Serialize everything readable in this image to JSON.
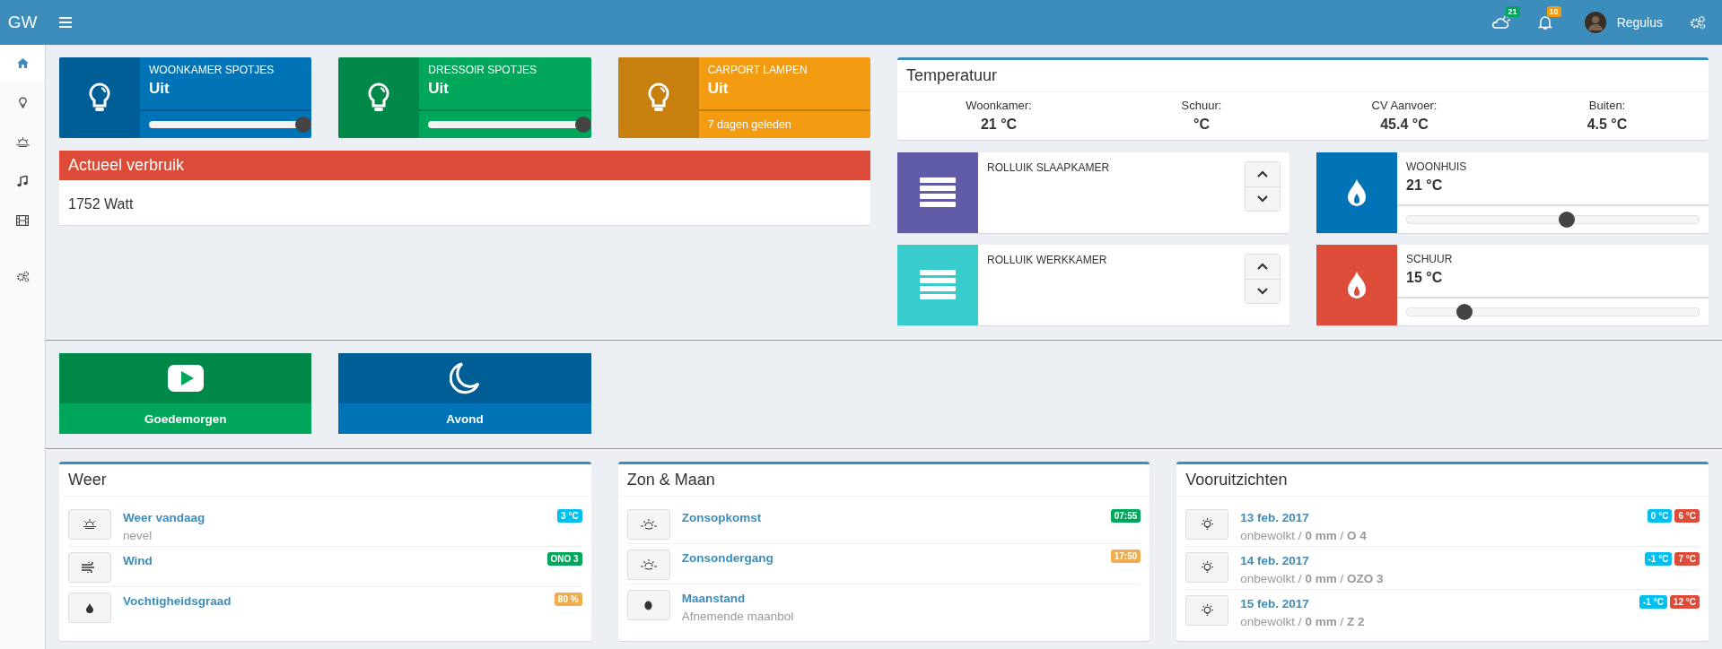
{
  "topbar": {
    "brand": "GW",
    "notifications": [
      {
        "kind": "weather",
        "count": "21",
        "color": "#00a65a"
      },
      {
        "kind": "bell",
        "count": "10",
        "color": "#f39c12"
      }
    ],
    "user": "Regulus"
  },
  "sidebar": {
    "items": [
      {
        "kind": "home",
        "selected": true
      },
      {
        "kind": "bulb",
        "selected": false
      },
      {
        "kind": "sunrise",
        "selected": false
      },
      {
        "kind": "music",
        "selected": false
      },
      {
        "kind": "film",
        "selected": false
      },
      {
        "kind": "gears",
        "selected": false
      }
    ]
  },
  "switches": [
    {
      "kind": "dimmer",
      "name": "WOONKAMER SPOTJES",
      "status": "Uit",
      "level": 1,
      "color": "#0073b7"
    },
    {
      "kind": "dimmer",
      "name": "DRESSOIR SPOTJES",
      "status": "Uit",
      "level": 1,
      "color": "#00a65a"
    },
    {
      "kind": "switch",
      "name": "CARPORT LAMPEN",
      "status": "Uit",
      "last_seen": "7 dagen geleden",
      "color": "#f39c12"
    }
  ],
  "usage": {
    "title": "Actueel verbruik",
    "value": "1752 Watt"
  },
  "temperature": {
    "title": "Temperatuur",
    "sensors": [
      {
        "label": "Woonkamer:",
        "value": "21 °C"
      },
      {
        "label": "Schuur:",
        "value": "°C"
      },
      {
        "label": "CV Aanvoer:",
        "value": "45.4 °C"
      },
      {
        "label": "Buiten:",
        "value": "4.5 °C"
      }
    ]
  },
  "blinds": [
    {
      "name": "ROLLUIK SLAAPKAMER",
      "color": "#605ca8"
    },
    {
      "name": "ROLLUIK WERKKAMER",
      "color": "#39cccc"
    }
  ],
  "thermostats": [
    {
      "name": "WOONHUIS",
      "value": "21 °C",
      "level": 0.55,
      "color": "#0073b7"
    },
    {
      "name": "SCHUUR",
      "value": "15 °C",
      "level": 0.18,
      "color": "#dd4b39"
    }
  ],
  "scenes": [
    {
      "kind": "play",
      "name": "Goedemorgen",
      "color": "#00a65a"
    },
    {
      "kind": "moon",
      "name": "Avond",
      "color": "#0073b7"
    }
  ],
  "widgets": [
    {
      "title": "Weer",
      "items": [
        {
          "kind": "fog",
          "title": "Weer vandaag",
          "subtitle": "nevel",
          "badges": [
            {
              "text": "3 °C",
              "color": "#00c0ef"
            }
          ]
        },
        {
          "kind": "wind",
          "title": "Wind",
          "badges": [
            {
              "text": "ONO 3",
              "color": "#00a65a"
            }
          ]
        },
        {
          "kind": "drop",
          "title": "Vochtigheidsgraad",
          "badges": [
            {
              "text": "80 %",
              "color": "#f0ad4e"
            }
          ]
        }
      ]
    },
    {
      "title": "Zon & Maan",
      "items": [
        {
          "kind": "sunrise",
          "title": "Zonsopkomst",
          "badges": [
            {
              "text": "07:55",
              "color": "#00a65a"
            }
          ]
        },
        {
          "kind": "sunset",
          "title": "Zonsondergang",
          "badges": [
            {
              "text": "17:50",
              "color": "#f0ad4e"
            }
          ]
        },
        {
          "kind": "moon",
          "title": "Maanstand",
          "subtitle": "Afnemende maanbol"
        }
      ]
    },
    {
      "title": "Vooruitzichten",
      "items": [
        {
          "kind": "sun",
          "title": "13 feb. 2017",
          "subtitle": "onbewolkt / **0 mm** / **O 4**",
          "badges": [
            {
              "text": "0 °C",
              "color": "#00c0ef"
            },
            {
              "text": "6 °C",
              "color": "#dd4b39"
            }
          ]
        },
        {
          "kind": "sun",
          "title": "14 feb. 2017",
          "subtitle": "onbewolkt / **0 mm** / **OZO 3**",
          "badges": [
            {
              "text": "-1 °C",
              "color": "#00c0ef"
            },
            {
              "text": "7 °C",
              "color": "#dd4b39"
            }
          ]
        },
        {
          "kind": "sun",
          "title": "15 feb. 2017",
          "subtitle": "onbewolkt / **0 mm** / **Z 2**",
          "badges": [
            {
              "text": "-1 °C",
              "color": "#00c0ef"
            },
            {
              "text": "12 °C",
              "color": "#dd4b39"
            }
          ]
        }
      ]
    }
  ]
}
